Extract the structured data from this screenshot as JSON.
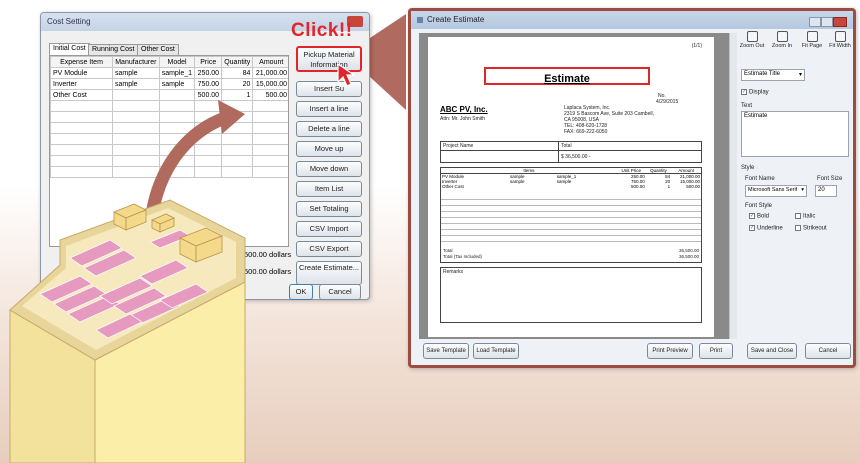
{
  "cost_setting": {
    "title": "Cost Setting",
    "tabs": [
      "Initial Cost",
      "Running Cost",
      "Other Cost"
    ],
    "columns": [
      "Expense Item",
      "Manufacturer",
      "Model",
      "Price",
      "Quantity",
      "Amount"
    ],
    "rows": [
      [
        "PV Module",
        "sample",
        "sample_1",
        "250.00",
        "84",
        "21,000.00"
      ],
      [
        "Inverter",
        "sample",
        "sample",
        "750.00",
        "20",
        "15,000.00"
      ],
      [
        "Other Cost",
        "",
        "",
        "500.00",
        "1",
        "500.00"
      ]
    ],
    "buttons": {
      "pickup": "Pickup Material Information",
      "insert_sub": "Insert Su",
      "insert_line": "Insert a line",
      "delete_line": "Delete a line",
      "move_up": "Move up",
      "move_down": "Move down",
      "item_list": "Item List",
      "set_totaling": "Set Totaling",
      "csv_import": "CSV Import",
      "csv_export": "CSV Export",
      "create_estimate": "Create Estimate...",
      "ok": "OK",
      "cancel": "Cancel"
    },
    "totals": [
      "500.00 dollars",
      "500.00 dollars"
    ],
    "click_callout": "Click!!"
  },
  "create_estimate": {
    "title": "Create Estimate",
    "doc": {
      "page_no": "(1/1)",
      "heading": "Estimate",
      "no_label": "No.",
      "date": "4/29/2015",
      "company": "ABC PV, Inc.",
      "attn": "Attn: Mr. John Smith",
      "vendor_lines": [
        "Laplaca System, Inc.",
        "2319 S Bascom Ave, Suite 203 Cambell,",
        "CA 95008, USA",
        "TEL: 408-620-1728",
        "FAX: 669-222-6050"
      ],
      "project_label": "Project Name",
      "total_label": "Total",
      "total_value": "$ 36,500.00 -",
      "cols": [
        "Items",
        "Unit Price",
        "Quantity",
        "Amount"
      ],
      "lines": [
        [
          "PV Module",
          "sample",
          "sample_1",
          "250.00",
          "84",
          "21,000.00"
        ],
        [
          "Inverter",
          "sample",
          "sample",
          "750.00",
          "20",
          "15,000.00"
        ],
        [
          "Other Cost",
          "",
          "",
          "500.00",
          "1",
          "500.00"
        ]
      ],
      "sum_total_label": "Total",
      "sum_total": "36,500.00",
      "tax_label": "Total (Tax Included)",
      "tax_total": "36,500.00",
      "remarks": "Remarks"
    },
    "toolbar": [
      "Zoom Out",
      "Zoom In",
      "Fit Page",
      "Fit Width"
    ],
    "panel": {
      "selector": "Estimate Title",
      "display": "Display",
      "text_label": "Text",
      "text_value": "Estimate",
      "style_label": "Style",
      "font_name_label": "Font Name",
      "font_size_label": "Font Size",
      "font_name": "Microsoft Sans Serif",
      "font_size": "20",
      "font_style_label": "Font Style",
      "bold": "Bold",
      "italic": "Italic",
      "underline": "Underline",
      "strikeout": "Strikeout"
    },
    "footer": {
      "save_template": "Save Template",
      "load_template": "Load Template",
      "print_preview": "Print Preview",
      "print": "Print",
      "save_close": "Save and Close",
      "cancel": "Cancel"
    }
  },
  "colors": {
    "accent_red": "#e0262a",
    "frame_brown": "#9b4d42"
  }
}
